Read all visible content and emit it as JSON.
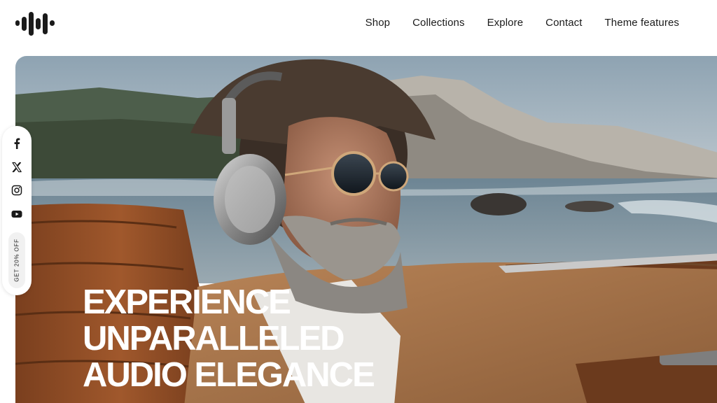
{
  "brand": {
    "logo_icon": "sound-wave-logo-icon",
    "color": "#1a1a1a"
  },
  "nav": {
    "items": [
      {
        "label": "Shop"
      },
      {
        "label": "Collections"
      },
      {
        "label": "Explore"
      },
      {
        "label": "Contact"
      },
      {
        "label": "Theme features"
      }
    ]
  },
  "hero": {
    "image": "man-with-headphones-and-sunglasses-in-convertible-by-sea",
    "headline_lines": [
      "EXPERIENCE",
      "UNPARALLELED",
      "AUDIO ELEGANCE"
    ],
    "headline_color": "#ffffff"
  },
  "social": {
    "icons": [
      "facebook-icon",
      "x-icon",
      "instagram-icon",
      "youtube-icon"
    ],
    "promo_label": "GET 20% OFF"
  }
}
